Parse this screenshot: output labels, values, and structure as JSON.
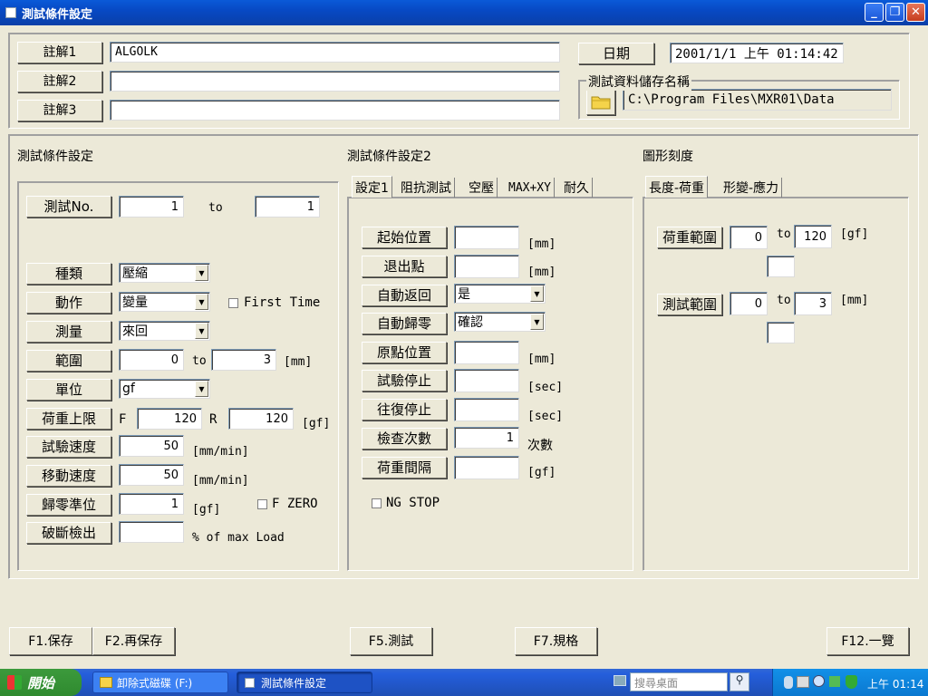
{
  "window": {
    "title": "測試條件設定",
    "minimize_glyph": "_",
    "restore_glyph": "❐",
    "close_glyph": "✕"
  },
  "notes": {
    "note1_label": "註解1",
    "note1_value": "ALGOLK",
    "note2_label": "註解2",
    "note2_value": "",
    "note3_label": "註解3",
    "note3_value": ""
  },
  "date": {
    "label": "日期",
    "value": "2001/1/1 上午 01:14:42"
  },
  "storage": {
    "group_label": "測試資料儲存名稱",
    "path": "C:\\Program Files\\MXR01\\Data",
    "folder_icon": "folder-icon"
  },
  "test_conditions": {
    "heading": "測試條件設定",
    "test_no_label": "測試No.",
    "test_no_from": "1",
    "to_text": "to",
    "test_no_to": "1",
    "type_label": "種類",
    "type_value": "壓縮",
    "action_label": "動作",
    "action_value": "變量",
    "first_time_label": "First Time",
    "measure_label": "測量",
    "measure_value": "來回",
    "range_label": "範圍",
    "range_from": "0",
    "range_to_text": "to",
    "range_to": "3",
    "range_unit": "[mm]",
    "unit_label": "單位",
    "unit_value": "gf",
    "load_limit_label": "荷重上限",
    "load_limit_f": "F",
    "load_limit_f_value": "120",
    "load_limit_r": "R",
    "load_limit_r_value": "120",
    "load_limit_unit": "[gf]",
    "test_speed_label": "試驗速度",
    "test_speed_value": "50",
    "test_speed_unit": "[mm/min]",
    "move_speed_label": "移動速度",
    "move_speed_value": "50",
    "move_speed_unit": "[mm/min]",
    "zero_level_label": "歸零準位",
    "zero_level_value": "1",
    "zero_level_unit": "[gf]",
    "f_zero_label": "F ZERO",
    "break_detect_label": "破斷檢出",
    "break_detect_value": "",
    "break_detect_unit": "% of max Load"
  },
  "test_conditions2": {
    "heading": "測試條件設定2",
    "tabs": [
      "設定1",
      "阻抗測試",
      "空壓",
      "MAX+XY",
      "耐久"
    ],
    "start_pos_label": "起始位置",
    "start_pos_unit": "[mm]",
    "exit_point_label": "退出點",
    "exit_point_unit": "[mm]",
    "auto_return_label": "自動返回",
    "auto_return_value": "是",
    "auto_zero_label": "自動歸零",
    "auto_zero_value": "確認",
    "origin_pos_label": "原點位置",
    "origin_pos_unit": "[mm]",
    "test_stop_label": "試驗停止",
    "test_stop_unit": "[sec]",
    "round_stop_label": "往復停止",
    "round_stop_unit": "[sec]",
    "check_count_label": "檢查次數",
    "check_count_value": "1",
    "check_count_unit": "次數",
    "load_interval_label": "荷重間隔",
    "load_interval_unit": "[gf]",
    "ng_stop_label": "NG STOP"
  },
  "graph_scale": {
    "heading": "圖形刻度",
    "tabs": [
      "長度-荷重",
      "形變-應力"
    ],
    "load_range_label": "荷重範圍",
    "load_range_from": "0",
    "load_range_to_text": "to",
    "load_range_to": "120",
    "load_range_unit": "[gf]",
    "measure_range_label": "測試範圍",
    "measure_range_from": "0",
    "measure_range_to_text": "to",
    "measure_range_to": "3",
    "measure_range_unit": "[mm]"
  },
  "function_keys": {
    "f1": "F1.保存",
    "f2": "F2.再保存",
    "f5": "F5.測試",
    "f7": "F7.規格",
    "f12": "F12.一覽"
  },
  "taskbar": {
    "start_label": "開始",
    "task1": "卸除式磁碟 (F:)",
    "task2": "測試條件設定",
    "search_placeholder": "搜尋桌面",
    "clock": "上午 01:14"
  }
}
